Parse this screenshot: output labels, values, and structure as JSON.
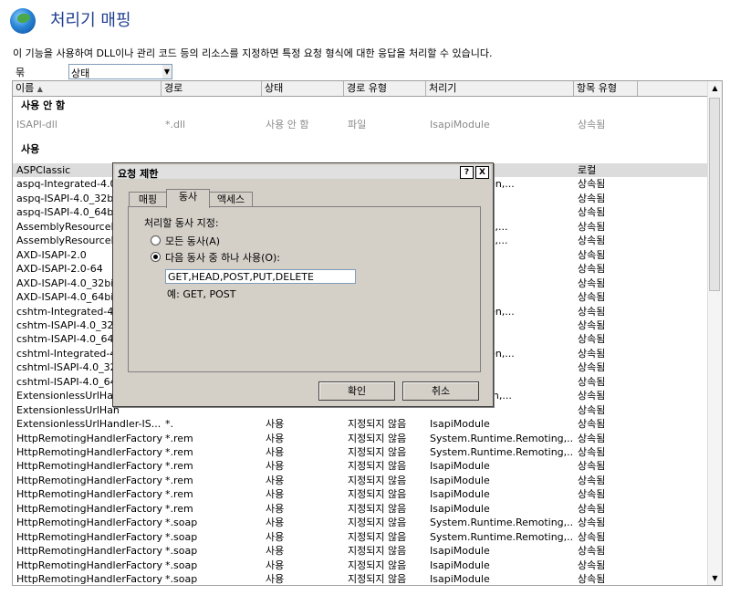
{
  "page": {
    "title": "처리기 매핑",
    "description": "이 기능을 사용하여 DLL이나 관리 코드 등의 리소스를 지정하면 특정 요청 형식에 대한 응답을 처리할 수 있습니다.",
    "group_by_label": "묶는 방법:",
    "group_by_value": "상태"
  },
  "columns": [
    "이름",
    "경로",
    "상태",
    "경로 유형",
    "처리기",
    "항목 유형"
  ],
  "groups": {
    "disabled": "사용 안 함",
    "enabled": "사용"
  },
  "disabled_rows": [
    [
      "ISAPI-dll",
      "*.dll",
      "사용 안 함",
      "파일",
      "IsapiModule",
      "상속됨"
    ]
  ],
  "enabled_rows": [
    [
      "ASPClassic",
      "",
      "",
      "",
      "",
      "로컬"
    ],
    [
      "aspq-Integrated-4.0",
      "",
      "",
      "",
      "HttpForbidden,...",
      "상속됨"
    ],
    [
      "aspq-ISAPI-4.0_32bit",
      "",
      "",
      "",
      "",
      "상속됨"
    ],
    [
      "aspq-ISAPI-4.0_64bit",
      "",
      "",
      "",
      "",
      "상속됨"
    ],
    [
      "AssemblyResourceL",
      "",
      "",
      "",
      "Handlers,Ass,...",
      "상속됨"
    ],
    [
      "AssemblyResourceL",
      "",
      "",
      "",
      "Handlers,Ass,...",
      "상속됨"
    ],
    [
      "AXD-ISAPI-2.0",
      "",
      "",
      "",
      "",
      "상속됨"
    ],
    [
      "AXD-ISAPI-2.0-64",
      "",
      "",
      "",
      "",
      "상속됨"
    ],
    [
      "AXD-ISAPI-4.0_32bit",
      "",
      "",
      "",
      "",
      "상속됨"
    ],
    [
      "AXD-ISAPI-4.0_64bit",
      "",
      "",
      "",
      "",
      "상속됨"
    ],
    [
      "cshtm-Integrated-4.0",
      "",
      "",
      "",
      "HttpForbidden,...",
      "상속됨"
    ],
    [
      "cshtm-ISAPI-4.0_32b",
      "",
      "",
      "",
      "",
      "상속됨"
    ],
    [
      "cshtm-ISAPI-4.0_64b",
      "",
      "",
      "",
      "",
      "상속됨"
    ],
    [
      "cshtml-Integrated-4.",
      "",
      "",
      "",
      "HttpForbidden,...",
      "상속됨"
    ],
    [
      "cshtml-ISAPI-4.0_32",
      "",
      "",
      "",
      "",
      "상속됨"
    ],
    [
      "cshtml-ISAPI-4.0_64",
      "",
      "",
      "",
      "",
      "상속됨"
    ],
    [
      "ExtensionlessUrlHan",
      "",
      "",
      "",
      "Handlers,Tran,...",
      "상속됨"
    ],
    [
      "ExtensionlessUrlHan",
      "",
      "",
      "",
      "",
      "상속됨"
    ],
    [
      "ExtensionlessUrlHandler-IS...",
      "*.",
      "사용",
      "지정되지 않음",
      "IsapiModule",
      "상속됨"
    ],
    [
      "HttpRemotingHandlerFactory,...",
      "*.rem",
      "사용",
      "지정되지 않음",
      "System.Runtime.Remoting,...",
      "상속됨"
    ],
    [
      "HttpRemotingHandlerFactory,...",
      "*.rem",
      "사용",
      "지정되지 않음",
      "System.Runtime.Remoting,...",
      "상속됨"
    ],
    [
      "HttpRemotingHandlerFactory,...",
      "*.rem",
      "사용",
      "지정되지 않음",
      "IsapiModule",
      "상속됨"
    ],
    [
      "HttpRemotingHandlerFactory,...",
      "*.rem",
      "사용",
      "지정되지 않음",
      "IsapiModule",
      "상속됨"
    ],
    [
      "HttpRemotingHandlerFactory,...",
      "*.rem",
      "사용",
      "지정되지 않음",
      "IsapiModule",
      "상속됨"
    ],
    [
      "HttpRemotingHandlerFactory,...",
      "*.rem",
      "사용",
      "지정되지 않음",
      "IsapiModule",
      "상속됨"
    ],
    [
      "HttpRemotingHandlerFactory,...",
      "*.soap",
      "사용",
      "지정되지 않음",
      "System.Runtime.Remoting,...",
      "상속됨"
    ],
    [
      "HttpRemotingHandlerFactory,...",
      "*.soap",
      "사용",
      "지정되지 않음",
      "System.Runtime.Remoting,...",
      "상속됨"
    ],
    [
      "HttpRemotingHandlerFactory,...",
      "*.soap",
      "사용",
      "지정되지 않음",
      "IsapiModule",
      "상속됨"
    ],
    [
      "HttpRemotingHandlerFactory,...",
      "*.soap",
      "사용",
      "지정되지 않음",
      "IsapiModule",
      "상속됨"
    ],
    [
      "HttpRemotingHandlerFactory,...",
      "*.soap",
      "사용",
      "지정되지 않음",
      "IsapiModule",
      "상속됨"
    ],
    [
      "HttpRemotingHandlerFactory,...",
      "*.soap",
      "사용",
      "지정되지 않음",
      "IsapiModule",
      "상속됨"
    ]
  ],
  "dialog": {
    "title": "요청 제한",
    "help": "?",
    "close": "X",
    "tabs": [
      "매핑",
      "동사",
      "액세스"
    ],
    "section_label": "처리할 동사 지정:",
    "radio_all": "모든 동사(A)",
    "radio_one": "다음 동사 중 하나 사용(O):",
    "verbs_value": "GET,HEAD,POST,PUT,DELETE",
    "example": "예: GET, POST",
    "ok": "확인",
    "cancel": "취소"
  }
}
